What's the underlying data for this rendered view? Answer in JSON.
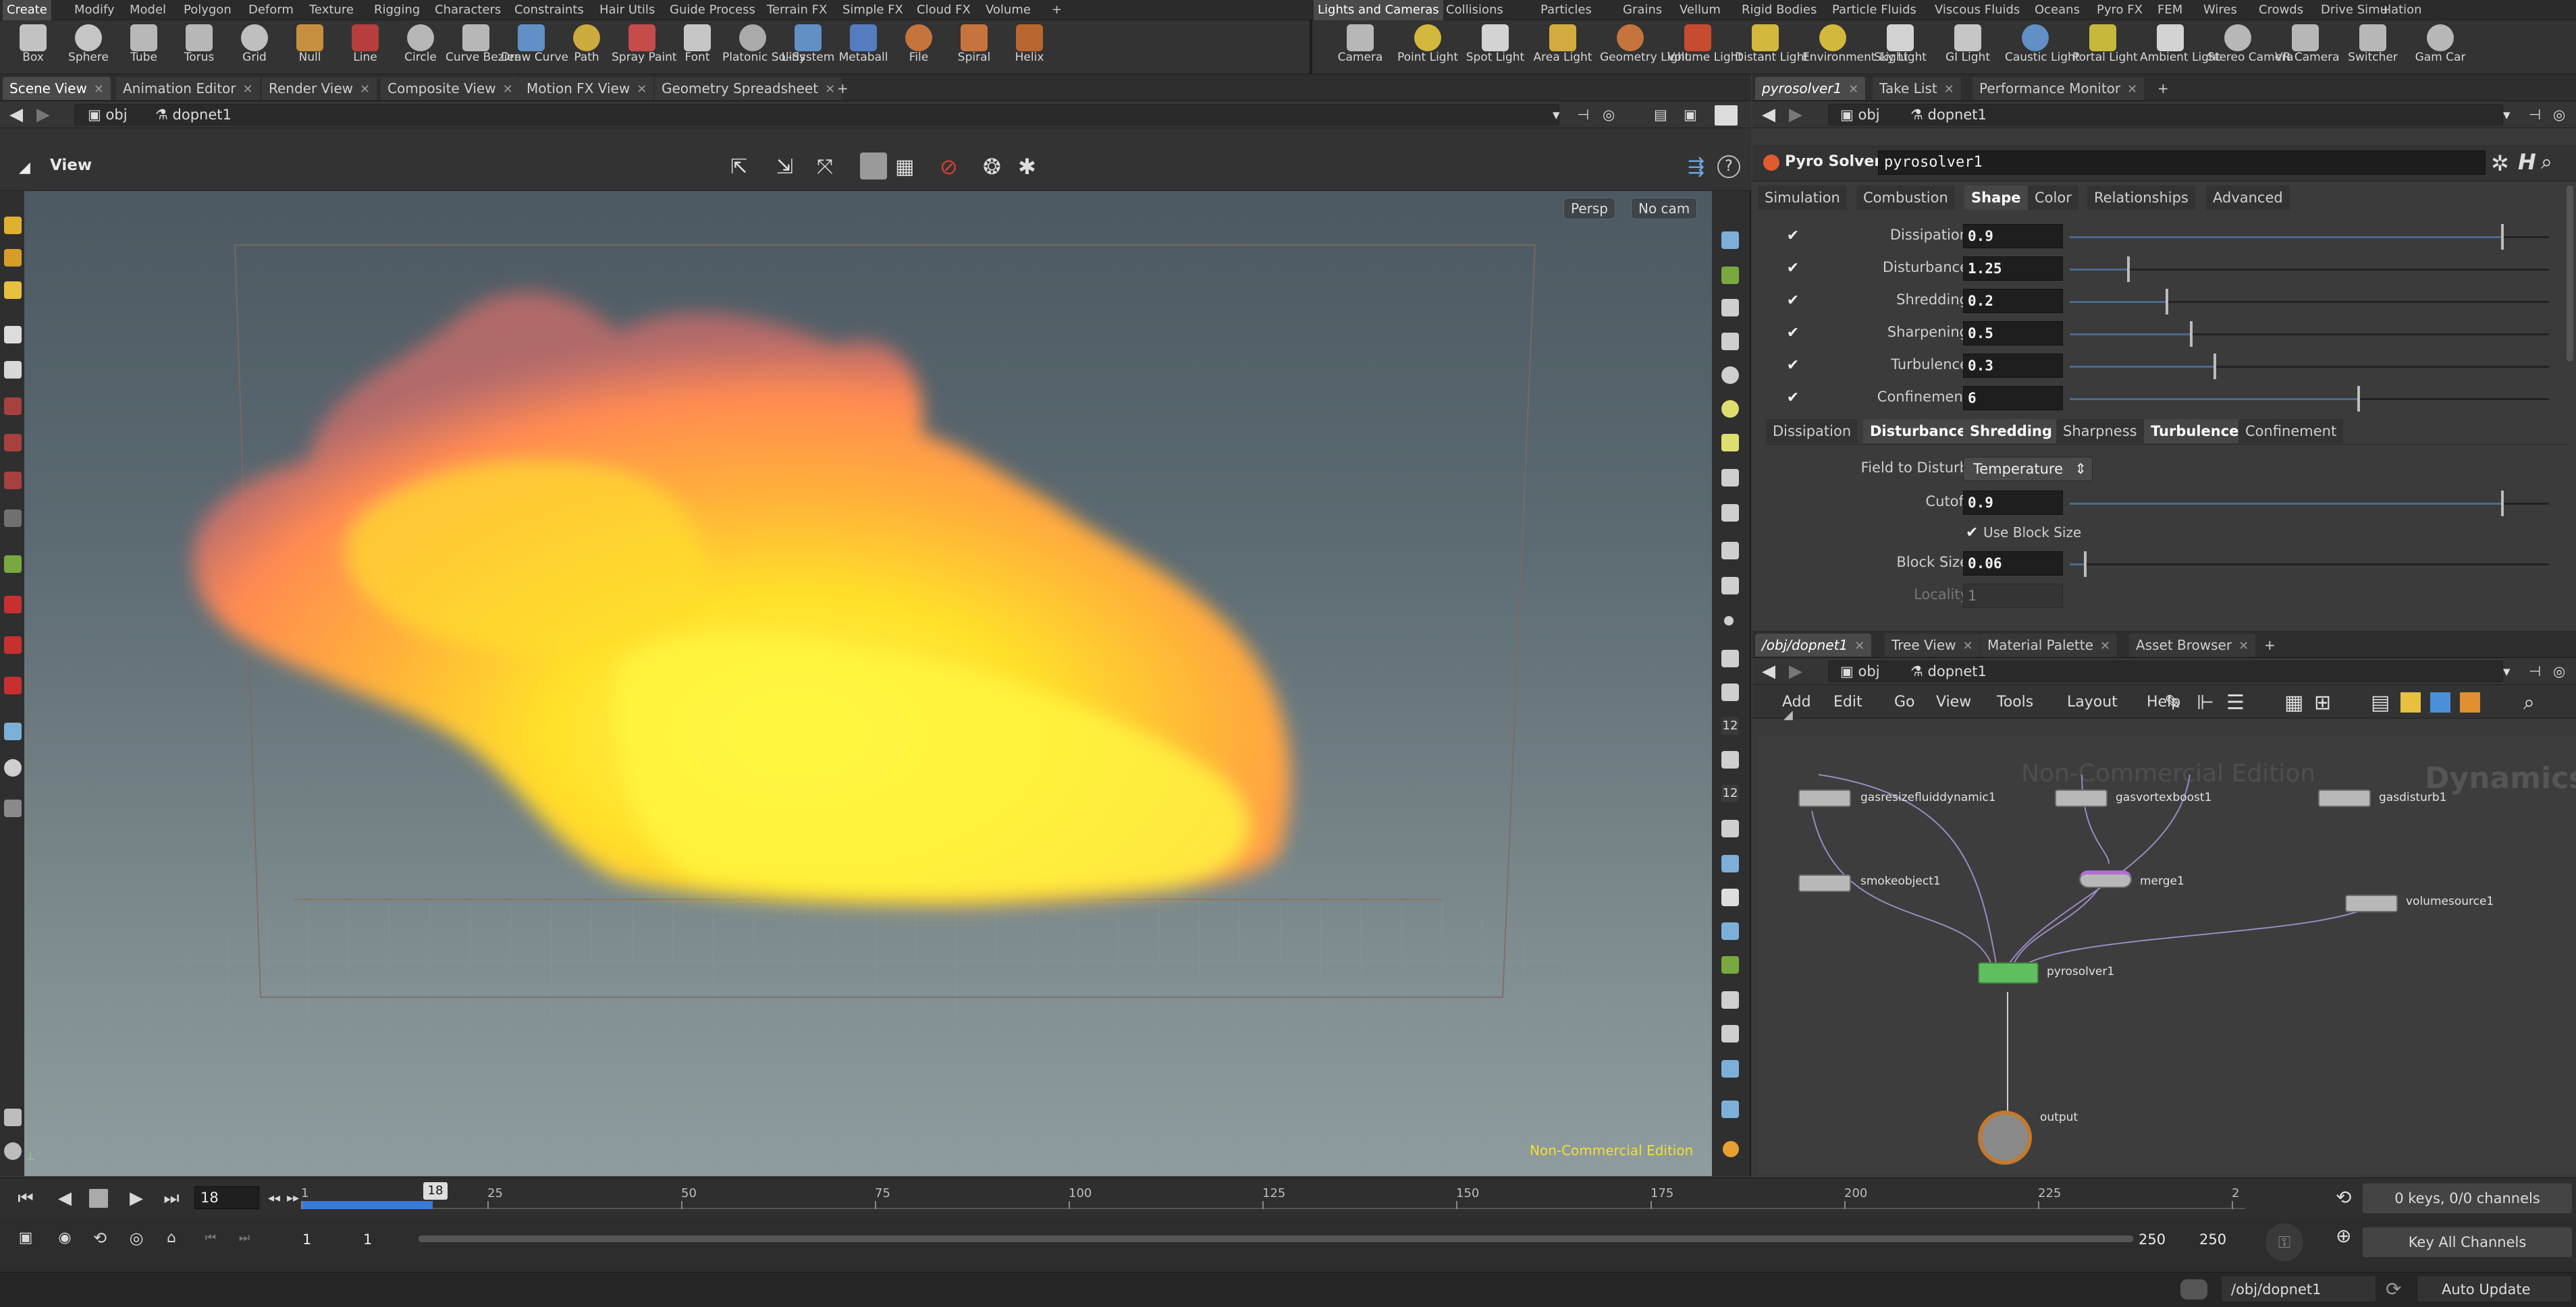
{
  "shelf": {
    "left_tabs": [
      "Create",
      "Modify",
      "Model",
      "Polygon",
      "Deform",
      "Texture",
      "Rigging",
      "Characters",
      "Constraints",
      "Hair Utils",
      "Guide Process",
      "Terrain FX",
      "Simple FX",
      "Cloud FX",
      "Volume",
      "+"
    ],
    "left_tools": [
      "Box",
      "Sphere",
      "Tube",
      "Torus",
      "Grid",
      "Null",
      "Line",
      "Circle",
      "Curve Bezier",
      "Draw Curve",
      "Path",
      "Spray Paint",
      "Font",
      "Platonic Solids",
      "L-System",
      "Metaball",
      "File",
      "Spiral",
      "Helix"
    ],
    "right_tabs": [
      "Lights and Cameras",
      "Collisions",
      "Particles",
      "Grains",
      "Vellum",
      "Rigid Bodies",
      "Particle Fluids",
      "Viscous Fluids",
      "Oceans",
      "Pyro FX",
      "FEM",
      "Wires",
      "Crowds",
      "Drive Simulation",
      "+"
    ],
    "right_tools": [
      "Camera",
      "Point Light",
      "Spot Light",
      "Area Light",
      "Geometry Light",
      "Volume Light",
      "Distant Light",
      "Environment Light",
      "Sky Light",
      "GI Light",
      "Caustic Light",
      "Portal Light",
      "Ambient Light",
      "Stereo Camera",
      "VR Camera",
      "Switcher",
      "Gam Car"
    ]
  },
  "left_pane": {
    "tabs": [
      "Scene View",
      "Animation Editor",
      "Render View",
      "Composite View",
      "Motion FX View",
      "Geometry Spreadsheet",
      "+"
    ],
    "path_root": "obj",
    "path_node": "dopnet1",
    "view_label": "View",
    "persp_btn": "Persp",
    "cam_btn": "No cam",
    "watermark": "Non-Commercial Edition"
  },
  "param_pane": {
    "tabs": [
      "pyrosolver1",
      "Take List",
      "Performance Monitor",
      "+"
    ],
    "path_root": "obj",
    "path_node": "dopnet1",
    "node_type": "Pyro Solver",
    "node_name": "pyrosolver1",
    "main_tabs": [
      "Simulation",
      "Combustion",
      "Shape",
      "Color",
      "Relationships",
      "Advanced"
    ],
    "shape_params": [
      {
        "label": "Dissipation",
        "value": "0.9",
        "fraction": 0.9
      },
      {
        "label": "Disturbance",
        "value": "1.25",
        "fraction": 0.12
      },
      {
        "label": "Shredding",
        "value": "0.2",
        "fraction": 0.2
      },
      {
        "label": "Sharpening",
        "value": "0.5",
        "fraction": 0.25
      },
      {
        "label": "Turbulence",
        "value": "0.3",
        "fraction": 0.3
      },
      {
        "label": "Confinement",
        "value": "6",
        "fraction": 0.6
      }
    ],
    "sub_tabs": [
      "Dissipation",
      "Disturbance",
      "Shredding",
      "Sharpness",
      "Turbulence",
      "Confinement"
    ],
    "field_to_disturb_label": "Field to Disturb",
    "field_to_disturb_value": "Temperature",
    "cutoff_label": "Cutoff",
    "cutoff_value": "0.9",
    "cutoff_fraction": 0.9,
    "use_block_size": "Use Block Size",
    "block_size_label": "Block Size",
    "block_size_value": "0.06",
    "block_size_fraction": 0.03,
    "locality_label": "Locality",
    "locality_value": "1"
  },
  "network_pane": {
    "tabs": [
      "/obj/dopnet1",
      "Tree View",
      "Material Palette",
      "Asset Browser",
      "+"
    ],
    "path_root": "obj",
    "path_node": "dopnet1",
    "menu": [
      "Add",
      "Edit",
      "Go",
      "View",
      "Tools",
      "Layout",
      "Help"
    ],
    "watermark": "Non-Commercial Edition",
    "context": "Dynamics",
    "nodes": [
      "gasresizefluiddynamic1",
      "gasvortexboost1",
      "gasdisturb1",
      "smokeobject1",
      "merge1",
      "volumesource1",
      "pyrosolver1",
      "output"
    ]
  },
  "timeline": {
    "current_frame": "18",
    "ticks": [
      "1",
      "25",
      "50",
      "75",
      "100",
      "125",
      "150",
      "175",
      "200",
      "225",
      "2"
    ],
    "range_start": "1",
    "range_start2": "1",
    "range_end": "250",
    "range_end2": "250",
    "keys_info": "0 keys, 0/0 channels",
    "key_all": "Key All Channels"
  },
  "status": {
    "path": "/obj/dopnet1",
    "update_mode": "Auto Update"
  }
}
